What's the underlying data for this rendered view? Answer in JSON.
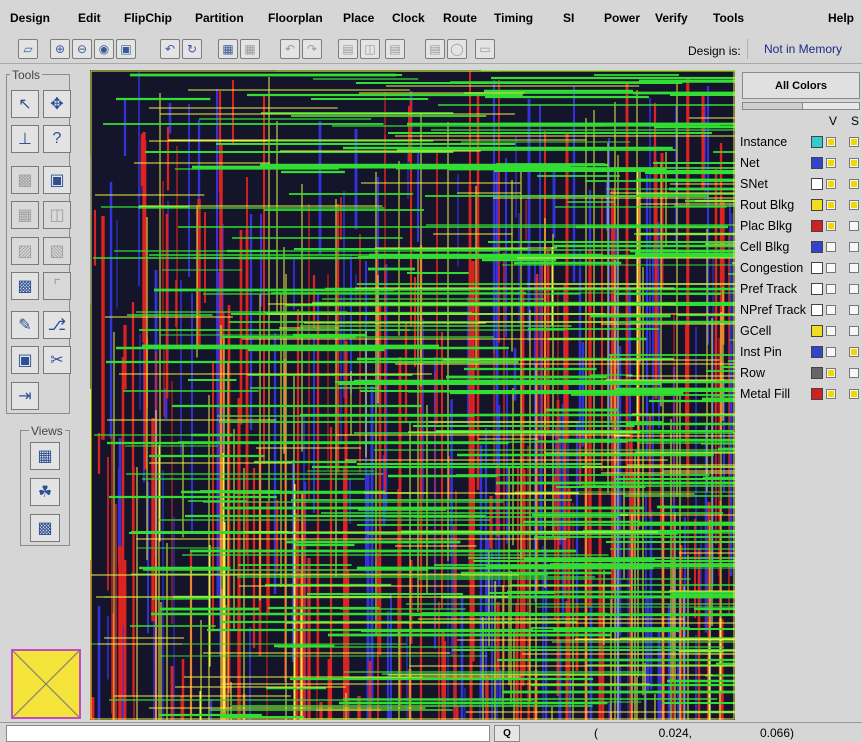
{
  "menu": [
    "Design",
    "Edit",
    "FlipChip",
    "Partition",
    "Floorplan",
    "Place",
    "Clock",
    "Route",
    "Timing",
    "SI",
    "Power",
    "Verify",
    "Tools",
    "Help"
  ],
  "toolbar": {
    "design_label": "Design is:",
    "design_value": "Not in Memory",
    "buttons": [
      "select-icon",
      "zoom-in-icon",
      "zoom-out-icon",
      "zoom-fit-icon",
      "zoom-selected-icon",
      "zoom-previous-icon",
      "refresh-icon",
      "layout-icon",
      "layout-alt-icon",
      "undo-icon",
      "redo-icon",
      "report-icon",
      "hierarchy-icon",
      "document-icon",
      "clipboard-icon",
      "camera-icon",
      "ruler-icon"
    ]
  },
  "tools": {
    "title": "Tools",
    "icons": [
      "select-arrow-icon",
      "move-icon",
      "ruler-icon",
      "question-icon",
      "floorplan-grid-icon",
      "block-icon",
      "grid-icon",
      "split-icon",
      "macro-icon",
      "macro-edit-icon",
      "dense-grid-icon",
      "corner-icon",
      "pen-icon",
      "wire-icon",
      "place-icon",
      "cut-icon",
      "flow-icon"
    ]
  },
  "views": {
    "title": "Views",
    "icons": [
      "floorplan-view-icon",
      "amoeba-view-icon",
      "physical-view-icon"
    ]
  },
  "layers": {
    "all_colors_label": "All Colors",
    "col_v": "V",
    "col_s": "S",
    "rows": [
      {
        "name": "Instance",
        "color": "#33cccc",
        "v": true,
        "s": true
      },
      {
        "name": "Net",
        "color": "#3344cc",
        "v": true,
        "s": true
      },
      {
        "name": "SNet",
        "color": "#ffffff",
        "v": true,
        "s": true
      },
      {
        "name": "Rout Blkg",
        "color": "#eedd22",
        "v": true,
        "s": true
      },
      {
        "name": "Plac Blkg",
        "color": "#cc2222",
        "v": true,
        "s": false
      },
      {
        "name": "Cell Blkg",
        "color": "#3344cc",
        "v": false,
        "s": false
      },
      {
        "name": "Congestion",
        "color": "#ffffff",
        "v": false,
        "s": false
      },
      {
        "name": "Pref Track",
        "color": "#ffffff",
        "v": false,
        "s": false
      },
      {
        "name": "NPref Track",
        "color": "#ffffff",
        "v": false,
        "s": false
      },
      {
        "name": "GCell",
        "color": "#eedd22",
        "v": false,
        "s": false
      },
      {
        "name": "Inst Pin",
        "color": "#3344cc",
        "v": false,
        "s": true
      },
      {
        "name": "Row",
        "color": "#666666",
        "v": true,
        "s": false
      },
      {
        "name": "Metal Fill",
        "color": "#cc2222",
        "v": true,
        "s": true
      }
    ]
  },
  "status": {
    "message": "",
    "query_label": "Q",
    "coord_open": "(",
    "coord_x": "0.024,",
    "coord_y": "0.066)"
  },
  "colors": {
    "canvas_bg": "#14142a",
    "wire_red": "#dd2222",
    "wire_blue": "#3333dd",
    "wire_green": "#33dd33",
    "wire_yellow": "#eeee44",
    "preview_fill": "#f3e33a",
    "preview_border": "#c04cc0"
  }
}
